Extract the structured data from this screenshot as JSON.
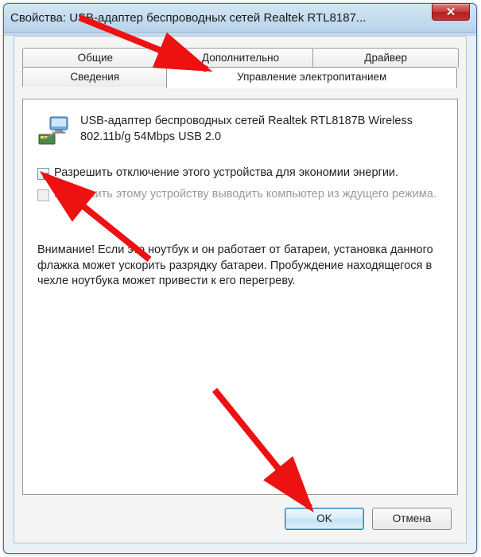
{
  "window": {
    "title": "Свойства: USB-адаптер беспроводных сетей Realtek RTL8187...",
    "close_label": "✕"
  },
  "tabs": {
    "row1": [
      "Общие",
      "Дополнительно",
      "Драйвер"
    ],
    "row2": [
      "Сведения",
      "Управление электропитанием"
    ],
    "active": "Управление электропитанием"
  },
  "device": {
    "name": "USB-адаптер беспроводных сетей Realtek RTL8187B Wireless 802.11b/g 54Mbps USB 2.0"
  },
  "options": {
    "allow_off": {
      "checked": false,
      "label": "Разрешить отключение этого устройства для экономии энергии."
    },
    "allow_wake": {
      "enabled": false,
      "label": "Разрешить этому устройству выводить компьютер из ждущего режима."
    }
  },
  "warning": "Внимание! Если это ноутбук и он работает от батареи, установка данного флажка может ускорить разрядку батареи. Пробуждение находящегося в чехле ноутбука может привести к его перегреву.",
  "buttons": {
    "ok": "OK",
    "cancel": "Отмена"
  }
}
